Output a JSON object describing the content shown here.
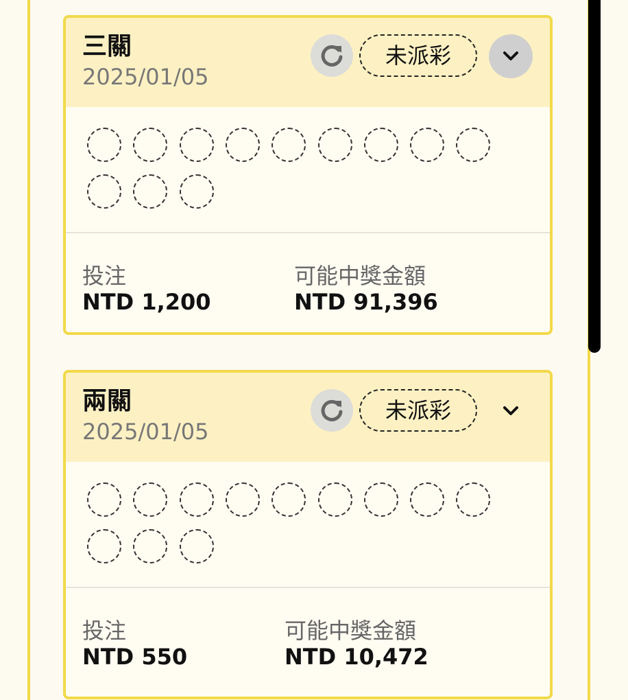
{
  "cards": [
    {
      "title": "三關",
      "date": "2025/01/05",
      "status": "未派彩",
      "stake_label": "投注",
      "stake_value": "NTD 1,200",
      "payout_label": "可能中獎金額",
      "payout_value": "NTD 91,396",
      "ball_count": 12,
      "expanded_button": true
    },
    {
      "title": "兩關",
      "date": "2025/01/05",
      "status": "未派彩",
      "stake_label": "投注",
      "stake_value": "NTD 550",
      "payout_label": "可能中獎金額",
      "payout_value": "NTD 10,472",
      "ball_count": 12,
      "expanded_button": false
    }
  ],
  "icons": {
    "refresh": "refresh-icon",
    "chevron": "chevron-down-icon"
  },
  "colors": {
    "accent": "#f2d94a",
    "header_bg": "#fdf1c3",
    "card_bg": "#fffcf2"
  }
}
